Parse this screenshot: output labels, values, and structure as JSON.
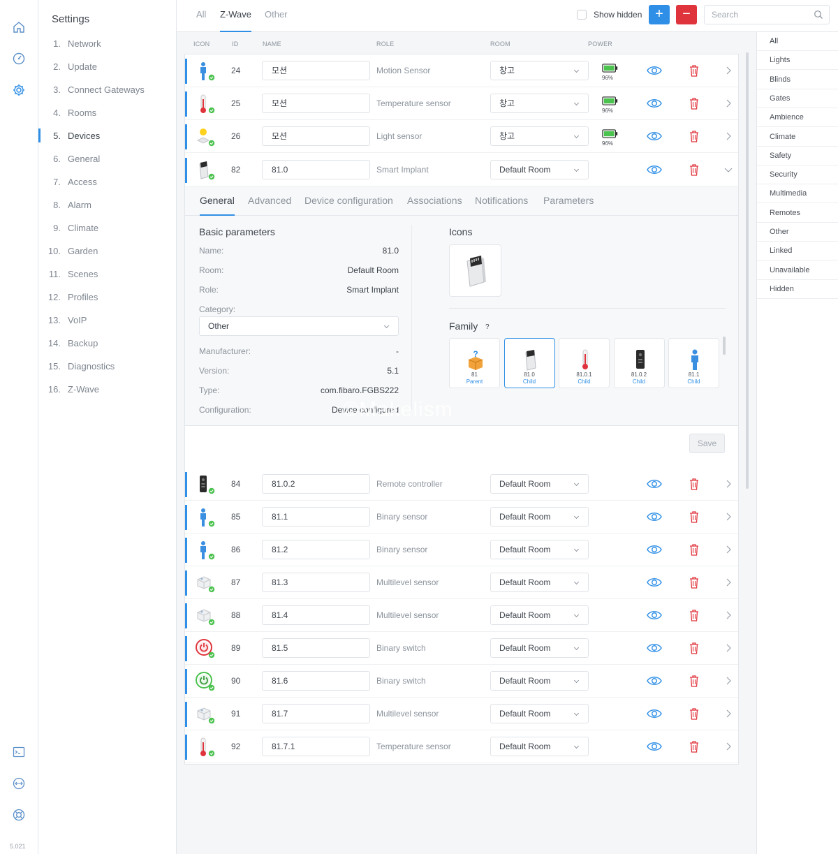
{
  "app": {
    "version": "5.021",
    "watermark": "©Makelism"
  },
  "menu": {
    "title": "Settings",
    "items": [
      {
        "num": "1.",
        "label": "Network"
      },
      {
        "num": "2.",
        "label": "Update"
      },
      {
        "num": "3.",
        "label": "Connect Gateways"
      },
      {
        "num": "4.",
        "label": "Rooms"
      },
      {
        "num": "5.",
        "label": "Devices",
        "active": true
      },
      {
        "num": "6.",
        "label": "General"
      },
      {
        "num": "7.",
        "label": "Access"
      },
      {
        "num": "8.",
        "label": "Alarm"
      },
      {
        "num": "9.",
        "label": "Climate"
      },
      {
        "num": "10.",
        "label": "Garden"
      },
      {
        "num": "11.",
        "label": "Scenes"
      },
      {
        "num": "12.",
        "label": "Profiles"
      },
      {
        "num": "13.",
        "label": "VoIP"
      },
      {
        "num": "14.",
        "label": "Backup"
      },
      {
        "num": "15.",
        "label": "Diagnostics"
      },
      {
        "num": "16.",
        "label": "Z-Wave"
      }
    ]
  },
  "topbar": {
    "tabs": [
      {
        "label": "All"
      },
      {
        "label": "Z-Wave",
        "active": true
      },
      {
        "label": "Other"
      }
    ],
    "show_hidden": "Show hidden",
    "add_label": "+",
    "remove_label": "−",
    "search_placeholder": "Search"
  },
  "columns": {
    "icon": "ICON",
    "id": "ID",
    "name": "NAME",
    "role": "ROLE",
    "room": "ROOM",
    "power": "POWER"
  },
  "devices": [
    {
      "icon": "motion-sensor-icon",
      "id": "24",
      "name": "모션",
      "role": "Motion Sensor",
      "room": "창고",
      "battery": "96%"
    },
    {
      "icon": "thermometer-icon",
      "id": "25",
      "name": "모션",
      "role": "Temperature sensor",
      "room": "창고",
      "battery": "96%"
    },
    {
      "icon": "light-sensor-icon",
      "id": "26",
      "name": "모션",
      "role": "Light sensor",
      "room": "창고",
      "battery": "96%"
    },
    {
      "icon": "smart-implant-icon",
      "id": "82",
      "name": "81.0",
      "role": "Smart Implant",
      "room": "Default Room",
      "expanded": true
    },
    {
      "icon": "remote-controller-icon",
      "id": "84",
      "name": "81.0.2",
      "role": "Remote controller",
      "room": "Default Room"
    },
    {
      "icon": "binary-sensor-icon",
      "id": "85",
      "name": "81.1",
      "role": "Binary sensor",
      "room": "Default Room"
    },
    {
      "icon": "binary-sensor-icon",
      "id": "86",
      "name": "81.2",
      "role": "Binary sensor",
      "room": "Default Room"
    },
    {
      "icon": "multilevel-sensor-icon",
      "id": "87",
      "name": "81.3",
      "role": "Multilevel sensor",
      "room": "Default Room"
    },
    {
      "icon": "multilevel-sensor-icon",
      "id": "88",
      "name": "81.4",
      "role": "Multilevel sensor",
      "room": "Default Room"
    },
    {
      "icon": "power-switch-off-icon",
      "id": "89",
      "name": "81.5",
      "role": "Binary switch",
      "room": "Default Room"
    },
    {
      "icon": "power-switch-on-icon",
      "id": "90",
      "name": "81.6",
      "role": "Binary switch",
      "room": "Default Room"
    },
    {
      "icon": "multilevel-sensor-icon",
      "id": "91",
      "name": "81.7",
      "role": "Multilevel sensor",
      "room": "Default Room"
    },
    {
      "icon": "thermometer-icon",
      "id": "92",
      "name": "81.7.1",
      "role": "Temperature sensor",
      "room": "Default Room"
    }
  ],
  "detail": {
    "tabs": [
      {
        "label": "General",
        "active": true
      },
      {
        "label": "Advanced"
      },
      {
        "label": "Device configuration"
      },
      {
        "label": "Associations"
      },
      {
        "label": "Notifications"
      },
      {
        "label": "Parameters"
      }
    ],
    "basic": {
      "title": "Basic parameters",
      "name_k": "Name:",
      "name_v": "81.0",
      "room_k": "Room:",
      "room_v": "Default Room",
      "role_k": "Role:",
      "role_v": "Smart Implant",
      "category_k": "Category:",
      "category_v": "Other",
      "manufacturer_k": "Manufacturer:",
      "manufacturer_v": "-",
      "version_k": "Version:",
      "version_v": "5.1",
      "type_k": "Type:",
      "type_v": "com.fibaro.FGBS222",
      "config_k": "Configuration:",
      "config_v": "Device configured"
    },
    "icons_title": "Icons",
    "family_title": "Family",
    "family_help": "?",
    "family": [
      {
        "id": "81",
        "role": "Parent",
        "icon": "parent-box-icon"
      },
      {
        "id": "81.0",
        "role": "Child",
        "icon": "smart-implant-icon",
        "selected": true
      },
      {
        "id": "81.0.1",
        "role": "Child",
        "icon": "thermometer-icon"
      },
      {
        "id": "81.0.2",
        "role": "Child",
        "icon": "remote-controller-icon"
      },
      {
        "id": "81.1",
        "role": "Child",
        "icon": "binary-sensor-icon"
      }
    ],
    "save_label": "Save"
  },
  "filters": [
    "All",
    "Lights",
    "Blinds",
    "Gates",
    "Ambience",
    "Climate",
    "Safety",
    "Security",
    "Multimedia",
    "Remotes",
    "Other",
    "Linked",
    "Unavailable",
    "Hidden"
  ],
  "colors": {
    "accent": "#2f8fe6",
    "danger": "#e0343c",
    "ok": "#4cc24f"
  }
}
